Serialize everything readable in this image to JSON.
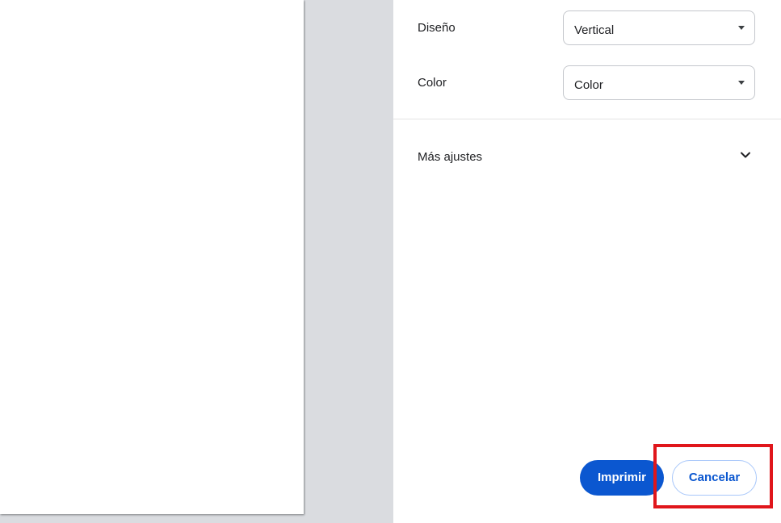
{
  "settings": {
    "layout": {
      "label": "Diseño",
      "value": "Vertical"
    },
    "color": {
      "label": "Color",
      "value": "Color"
    },
    "more_settings": {
      "label": "Más ajustes"
    }
  },
  "actions": {
    "print_label": "Imprimir",
    "cancel_label": "Cancelar"
  },
  "colors": {
    "accent": "#0b57d0",
    "highlight": "#e0161b",
    "preview_background": "#dadce0"
  },
  "icons": {
    "select_caret": "caret-down-icon",
    "expand": "chevron-down-icon"
  }
}
